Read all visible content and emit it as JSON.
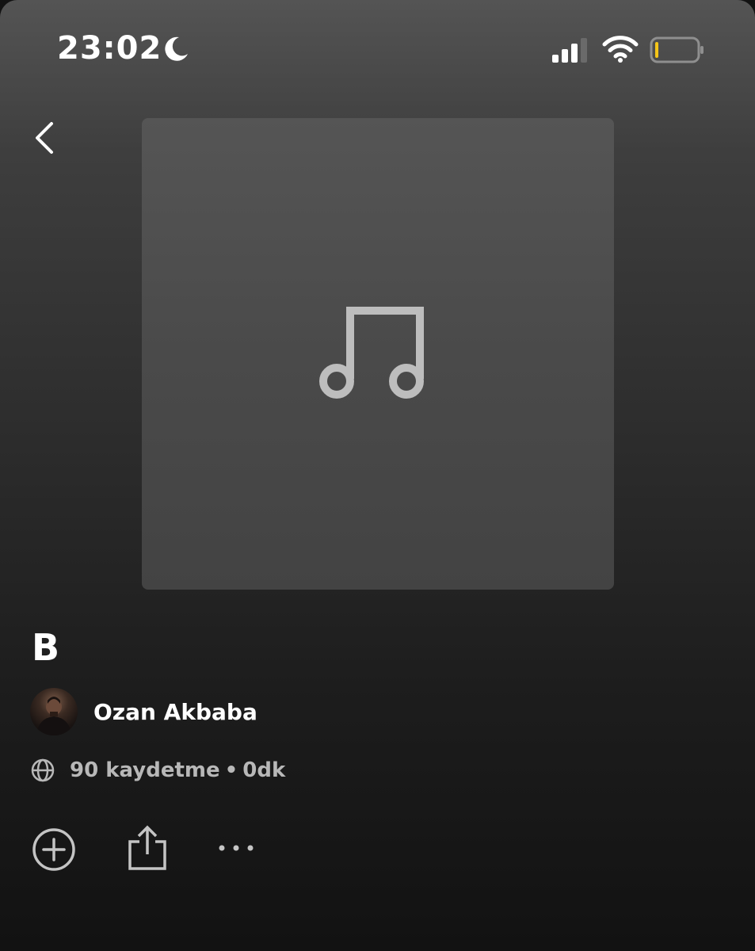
{
  "status_bar": {
    "time": "23:02",
    "moon_icon": "moon-icon",
    "signal_icon": "cellular-signal-icon",
    "wifi_icon": "wifi-icon",
    "battery_icon": "battery-low-icon",
    "battery_color": "#f5c518"
  },
  "header": {
    "back_icon": "chevron-left-icon"
  },
  "cover": {
    "placeholder_icon": "music-note-icon"
  },
  "playlist": {
    "title": "B",
    "owner_name": "Ozan Akbaba",
    "visibility_icon": "globe-icon",
    "saves": "90 kaydetme",
    "separator": "•",
    "duration": "0dk"
  },
  "actions": {
    "add_icon": "plus-circle-icon",
    "share_icon": "share-icon",
    "more_icon": "more-horizontal-icon"
  },
  "colors": {
    "background_top": "#545454",
    "background_bottom": "#121212",
    "text_primary": "#ffffff",
    "text_secondary": "#b8b8b8",
    "icon": "#c4c4c4"
  }
}
